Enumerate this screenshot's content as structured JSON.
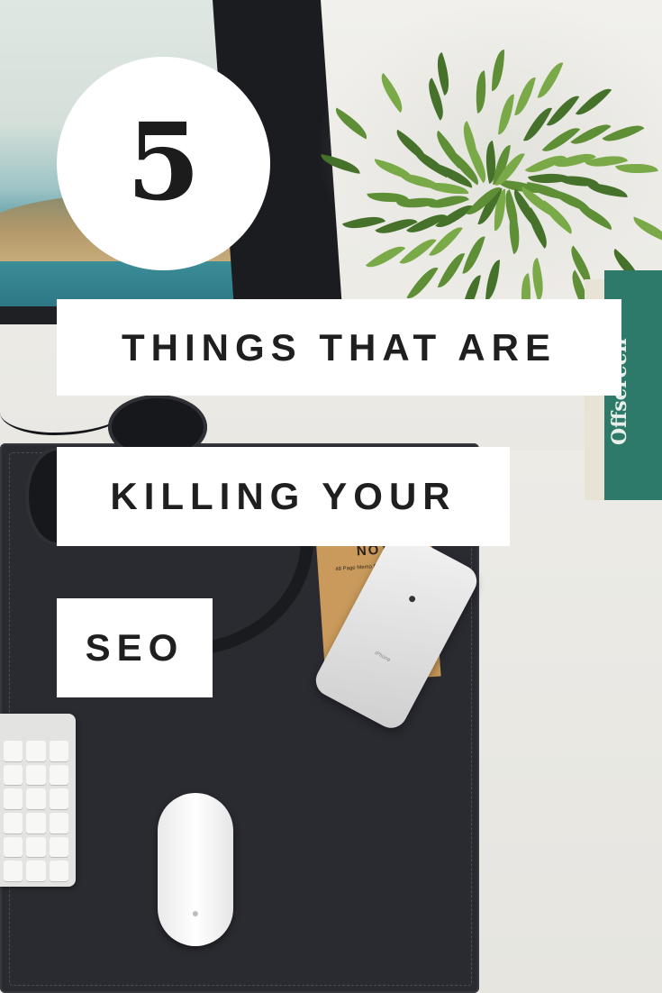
{
  "overlay": {
    "number": "5",
    "line1": "THINGS THAT ARE",
    "line2": "KILLING YOUR",
    "line3": "SEO"
  },
  "photo": {
    "book_spine": "Offscreen",
    "notebook_label": "NOTE",
    "notebook_sub": "48 Page Memo Durable Materials",
    "phone_text": "iPhone"
  },
  "colors": {
    "overlay_white": "#ffffff",
    "text_dark": "#1f1f1f",
    "desk_mat": "#2a2b31",
    "plant_green": "#5e8e36",
    "book_teal": "#2d7a6a"
  }
}
